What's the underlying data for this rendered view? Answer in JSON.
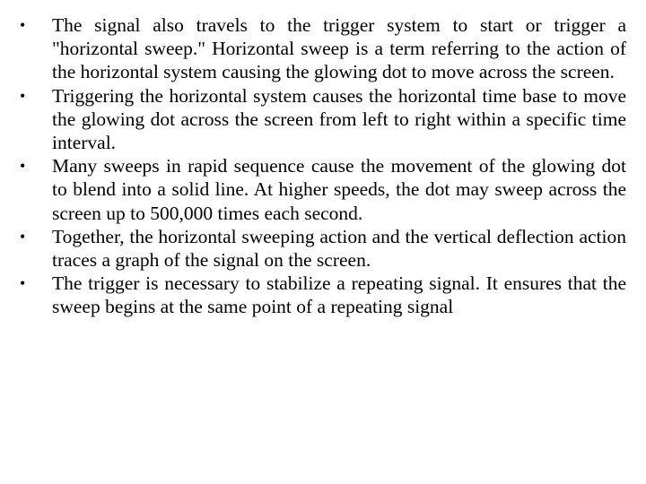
{
  "slide": {
    "bullet_glyph": "•",
    "items": [
      {
        "text": "The signal also travels to the trigger system to start or trigger a \"horizontal sweep.\" Horizontal sweep is a term referring to the action of the horizontal system causing the glowing dot to move across the screen."
      },
      {
        "text": "Triggering the horizontal system causes the horizontal time base to move the glowing dot across the screen from left to right within a specific time interval."
      },
      {
        "text": "Many sweeps in rapid sequence cause the movement of the glowing dot to blend into a solid line. At higher speeds, the dot may sweep across the screen up to 500,000 times each second."
      },
      {
        "text": "Together, the horizontal sweeping action and the vertical deflection action traces a graph of the signal on the screen."
      },
      {
        "text": "The trigger is necessary to stabilize a repeating signal. It ensures that the sweep begins at the same point of a repeating signal"
      }
    ]
  }
}
